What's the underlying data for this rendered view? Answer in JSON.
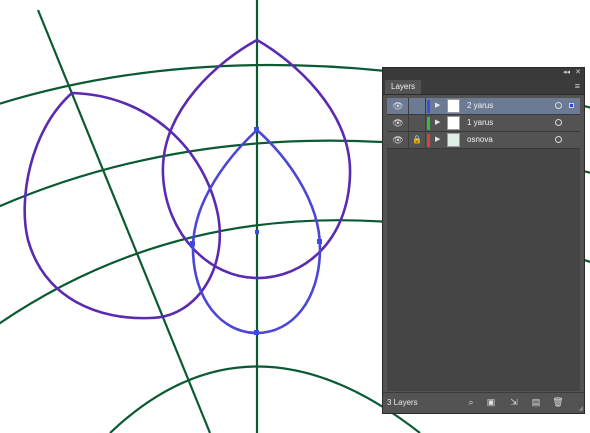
{
  "panel": {
    "tab_label": "Layers",
    "collapse_glyph": "◂◂",
    "close_glyph": "✕",
    "menu_glyph": "≡",
    "footer_count": "3 Layers",
    "layers": [
      {
        "name": "2 yarus",
        "color": "#3b4fd8",
        "selected": true,
        "locked": false
      },
      {
        "name": "1 yarus",
        "color": "#2fbf3a",
        "selected": false,
        "locked": false
      },
      {
        "name": "osnova",
        "color": "#e0403a",
        "selected": false,
        "locked": true
      }
    ],
    "footer_icons": [
      "search-icon",
      "make-clipping-mask-icon",
      "create-sublayer-icon",
      "new-layer-icon",
      "trash-icon"
    ]
  },
  "artwork": {
    "guide_color": "#0b5a32",
    "path_color": "#5a2bb0",
    "selected_path_color": "#4b46d6",
    "anchor_color": "#3d4be0"
  }
}
